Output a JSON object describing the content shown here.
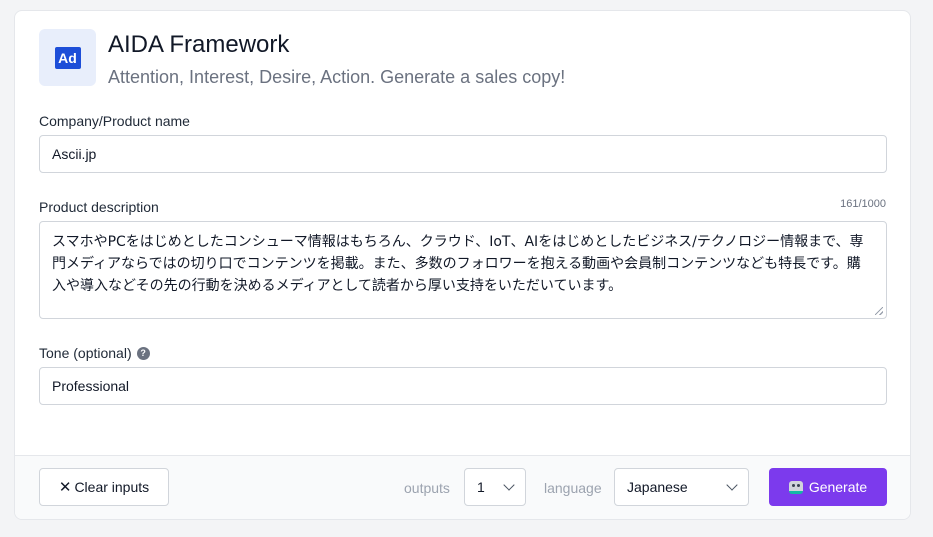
{
  "header": {
    "logo_text": "Ad",
    "title": "AIDA Framework",
    "subtitle": "Attention, Interest, Desire, Action. Generate a sales copy!"
  },
  "fields": {
    "company": {
      "label": "Company/Product name",
      "value": "Ascii.jp"
    },
    "description": {
      "label": "Product description",
      "counter": "161/1000",
      "value": "スマホやPCをはじめとしたコンシューマ情報はもちろん、クラウド、IoT、AIをはじめとしたビジネス/テクノロジー情報まで、専門メディアならではの切り口でコンテンツを掲載。また、多数のフォロワーを抱える動画や会員制コンテンツなども特長です。購入や導入などその先の行動を決めるメディアとして読者から厚い支持をいただいています。"
    },
    "tone": {
      "label": "Tone (optional)",
      "help": "?",
      "value": "Professional"
    }
  },
  "footer": {
    "clear_label": "Clear inputs",
    "clear_icon": "✕",
    "outputs_label": "outputs",
    "outputs_value": "1",
    "language_label": "language",
    "language_value": "Japanese",
    "generate_label": "Generate"
  },
  "colors": {
    "accent": "#7c3aed",
    "logo": "#1d4ed8"
  }
}
